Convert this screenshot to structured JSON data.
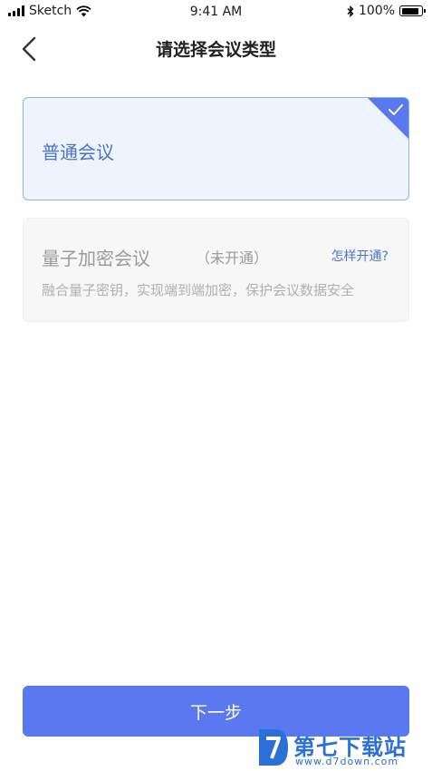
{
  "status_bar": {
    "carrier": "Sketch",
    "time": "9:41 AM",
    "battery": "100%",
    "battery_level": 1.0
  },
  "nav": {
    "title": "请选择会议类型"
  },
  "options": [
    {
      "title": "普通会议",
      "selected": true
    },
    {
      "title": "量子加密会议",
      "status": "（未开通）",
      "link": "怎样开通?",
      "description": "融合量子密钥，实现端到端加密，保护会议数据安全",
      "selected": false
    }
  ],
  "footer": {
    "next_label": "下一步"
  },
  "watermark": {
    "name": "第七下载站",
    "url": "www.d7down.com"
  },
  "colors": {
    "accent": "#5a78f0",
    "selected_text": "#4b73c9",
    "selected_bg": "#eef4fd",
    "selected_border": "#8fb3e8",
    "disabled_bg": "#f7f7f7"
  }
}
